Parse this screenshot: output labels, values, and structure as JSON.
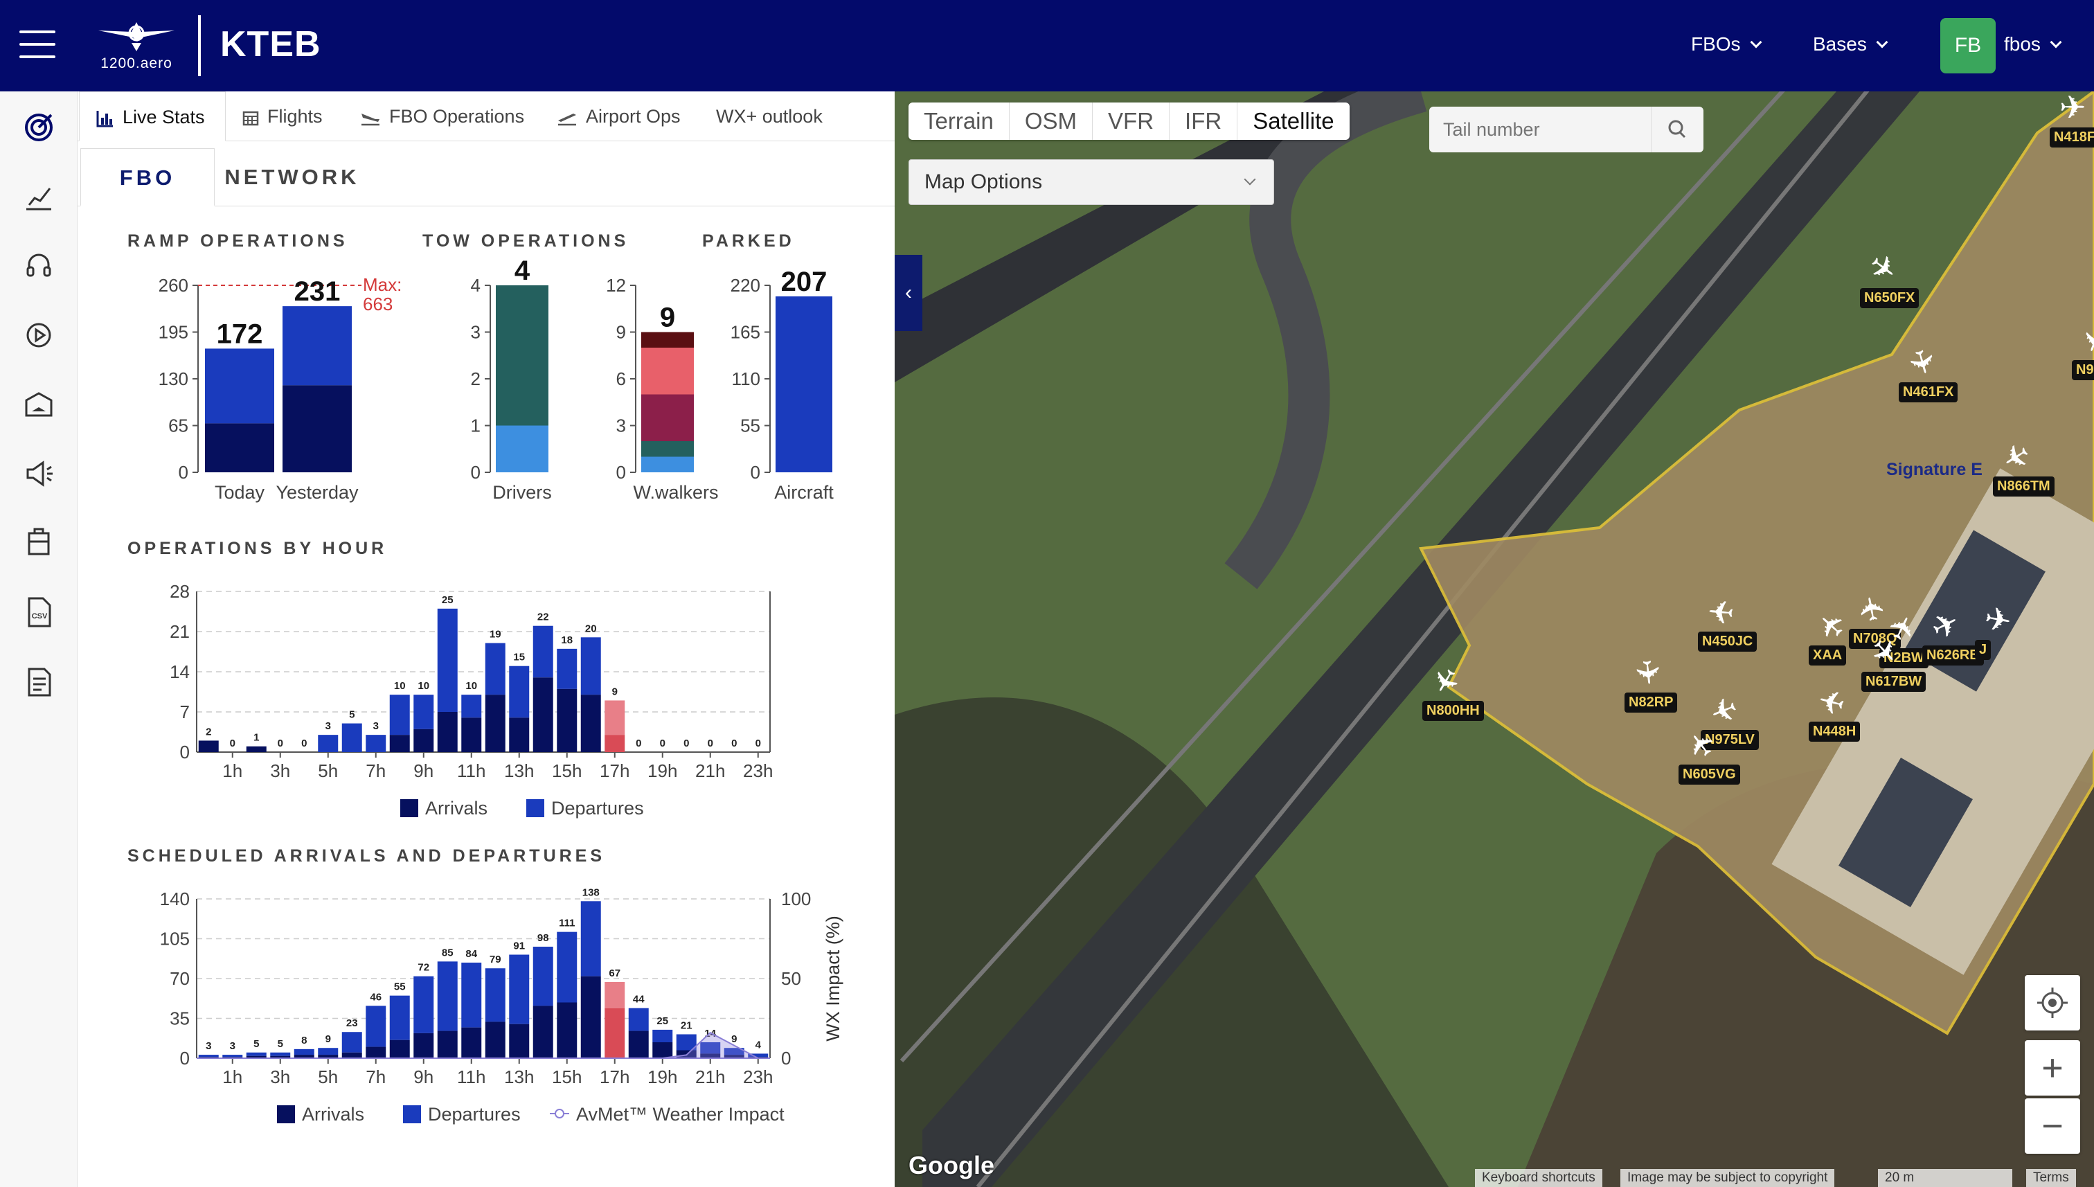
{
  "header": {
    "logo_text": "1200.aero",
    "airport": "KTEB",
    "nav": [
      "FBOs",
      "Bases"
    ],
    "user_initials": "FB",
    "user_name": "fbos"
  },
  "sidebar": {
    "icons": [
      "radar-icon",
      "trend-chart-icon",
      "headset-icon",
      "replay-icon",
      "hangar-icon",
      "megaphone-icon",
      "fuel-truck-icon",
      "csv-file-icon",
      "report-file-icon"
    ]
  },
  "tabs": [
    {
      "label": "Live Stats",
      "icon": "bar-chart-icon",
      "active": true
    },
    {
      "label": "Flights",
      "icon": "calendar-icon"
    },
    {
      "label": "FBO Operations",
      "icon": "plane-landing-icon"
    },
    {
      "label": "Airport Ops",
      "icon": "plane-takeoff-icon"
    },
    {
      "label": "WX+ outlook",
      "icon": ""
    }
  ],
  "subtabs": [
    "FBO",
    "NETWORK"
  ],
  "colors": {
    "navy": "#030a6b",
    "arrivals": "#06105e",
    "departures": "#1a3bbd",
    "highlight": "#e8606a",
    "tow_dark": "#24605e",
    "tow_light": "#3d8fe0",
    "max_line": "#d43a3a"
  },
  "ramp_operations": {
    "title": "RAMP OPERATIONS",
    "yticks": [
      "260",
      "195",
      "130",
      "65",
      "0"
    ],
    "ylim": [
      0,
      260
    ],
    "max_label_1": "Max:",
    "max_label_2": "663",
    "max_line_value": 260,
    "bars": [
      {
        "label": "Today",
        "total": 172,
        "total_text": "172",
        "arrivals": 68
      },
      {
        "label": "Yesterday",
        "total": 231,
        "total_text": "231",
        "arrivals": 121
      }
    ]
  },
  "tow_operations": {
    "title": "TOW OPERATIONS",
    "drivers": {
      "label": "Drivers",
      "total": 4,
      "total_text": "4",
      "yticks": [
        "4",
        "3",
        "2",
        "1",
        "0"
      ],
      "ylim": [
        0,
        4
      ],
      "segments": [
        1,
        3
      ]
    },
    "walkers": {
      "label": "W.walkers",
      "total": 9,
      "total_text": "9",
      "yticks": [
        "12",
        "9",
        "6",
        "3",
        "0"
      ],
      "ylim": [
        0,
        12
      ],
      "segments": [
        1,
        1,
        3,
        3,
        1
      ]
    }
  },
  "parked": {
    "title": "PARKED",
    "label": "Aircraft",
    "total": 207,
    "total_text": "207",
    "yticks": [
      "220",
      "165",
      "110",
      "55",
      "0"
    ],
    "ylim": [
      0,
      220
    ]
  },
  "chart_data": [
    {
      "type": "bar",
      "title": "OPERATIONS BY HOUR",
      "categories": [
        "0h",
        "1h",
        "2h",
        "3h",
        "4h",
        "5h",
        "6h",
        "7h",
        "8h",
        "9h",
        "10h",
        "11h",
        "12h",
        "13h",
        "14h",
        "15h",
        "16h",
        "17h",
        "18h",
        "19h",
        "20h",
        "21h",
        "22h",
        "23h"
      ],
      "xtick_labels": [
        "1h",
        "3h",
        "5h",
        "7h",
        "9h",
        "11h",
        "13h",
        "15h",
        "17h",
        "19h",
        "21h",
        "23h"
      ],
      "yticks": [
        "28",
        "21",
        "14",
        "7",
        "0"
      ],
      "ylim": [
        0,
        28
      ],
      "totals": [
        2,
        0,
        1,
        0,
        0,
        3,
        5,
        3,
        10,
        10,
        25,
        10,
        19,
        15,
        22,
        18,
        20,
        9,
        0,
        0,
        0,
        0,
        0,
        0
      ],
      "series": [
        {
          "name": "Arrivals",
          "values": [
            2,
            0,
            1,
            0,
            0,
            0,
            0,
            0,
            3,
            4,
            7,
            6,
            10,
            6,
            13,
            11,
            10,
            3,
            0,
            0,
            0,
            0,
            0,
            0
          ]
        },
        {
          "name": "Departures",
          "values": [
            0,
            0,
            0,
            0,
            0,
            3,
            5,
            3,
            7,
            6,
            18,
            4,
            9,
            9,
            9,
            7,
            10,
            6,
            0,
            0,
            0,
            0,
            0,
            0
          ]
        }
      ],
      "highlight_index": 17,
      "legend": [
        "Arrivals",
        "Departures"
      ]
    },
    {
      "type": "bar",
      "title": "SCHEDULED ARRIVALS AND DEPARTURES",
      "categories": [
        "0h",
        "1h",
        "2h",
        "3h",
        "4h",
        "5h",
        "6h",
        "7h",
        "8h",
        "9h",
        "10h",
        "11h",
        "12h",
        "13h",
        "14h",
        "15h",
        "16h",
        "17h",
        "18h",
        "19h",
        "20h",
        "21h",
        "22h",
        "23h"
      ],
      "xtick_labels": [
        "1h",
        "3h",
        "5h",
        "7h",
        "9h",
        "11h",
        "13h",
        "15h",
        "17h",
        "19h",
        "21h",
        "23h"
      ],
      "yticks": [
        "140",
        "105",
        "70",
        "35",
        "0"
      ],
      "ylim": [
        0,
        140
      ],
      "y2ticks": [
        "100",
        "50",
        "0"
      ],
      "y2lim": [
        0,
        100
      ],
      "y2label": "WX Impact (%)",
      "totals": [
        3,
        3,
        5,
        5,
        8,
        9,
        23,
        46,
        55,
        72,
        85,
        84,
        79,
        91,
        98,
        111,
        138,
        67,
        44,
        25,
        21,
        14,
        9,
        4
      ],
      "series": [
        {
          "name": "Arrivals",
          "values": [
            1,
            1,
            2,
            2,
            3,
            3,
            5,
            10,
            16,
            22,
            24,
            27,
            32,
            30,
            46,
            49,
            72,
            44,
            24,
            14,
            7,
            4,
            3,
            1
          ]
        },
        {
          "name": "Departures",
          "values": [
            2,
            2,
            3,
            3,
            5,
            6,
            18,
            36,
            39,
            50,
            61,
            57,
            47,
            61,
            52,
            62,
            66,
            23,
            20,
            11,
            14,
            10,
            6,
            3
          ]
        },
        {
          "name": "AvMet™ Weather Impact",
          "values": [
            0,
            0,
            0,
            0,
            0,
            0,
            0,
            0,
            0,
            0,
            0,
            0,
            0,
            0,
            0,
            0,
            0,
            0,
            0,
            0,
            2,
            16,
            8,
            0
          ]
        }
      ],
      "highlight_index": 17,
      "legend": [
        "Arrivals",
        "Departures",
        "AvMet™ Weather Impact"
      ]
    }
  ],
  "map": {
    "map_types": [
      "Terrain",
      "OSM",
      "VFR",
      "IFR",
      "Satellite"
    ],
    "selected_type": "Satellite",
    "options_label": "Map Options",
    "tail_placeholder": "Tail number",
    "fbo_label": "Signature E",
    "aircraft": [
      "N418F",
      "N650FX",
      "N461FX",
      "N9",
      "N866TM",
      "N450JC",
      "XAA",
      "N708Q",
      "N2BW",
      "N626RB",
      "J",
      "N617BW",
      "N82RP",
      "N800HH",
      "N975LV",
      "N448H",
      "N605VG"
    ],
    "google": "Google",
    "attributions": [
      "Keyboard shortcuts",
      "Image may be subject to copyright",
      "20 m",
      "Terms"
    ],
    "zoom_in": "+",
    "zoom_out": "−"
  }
}
